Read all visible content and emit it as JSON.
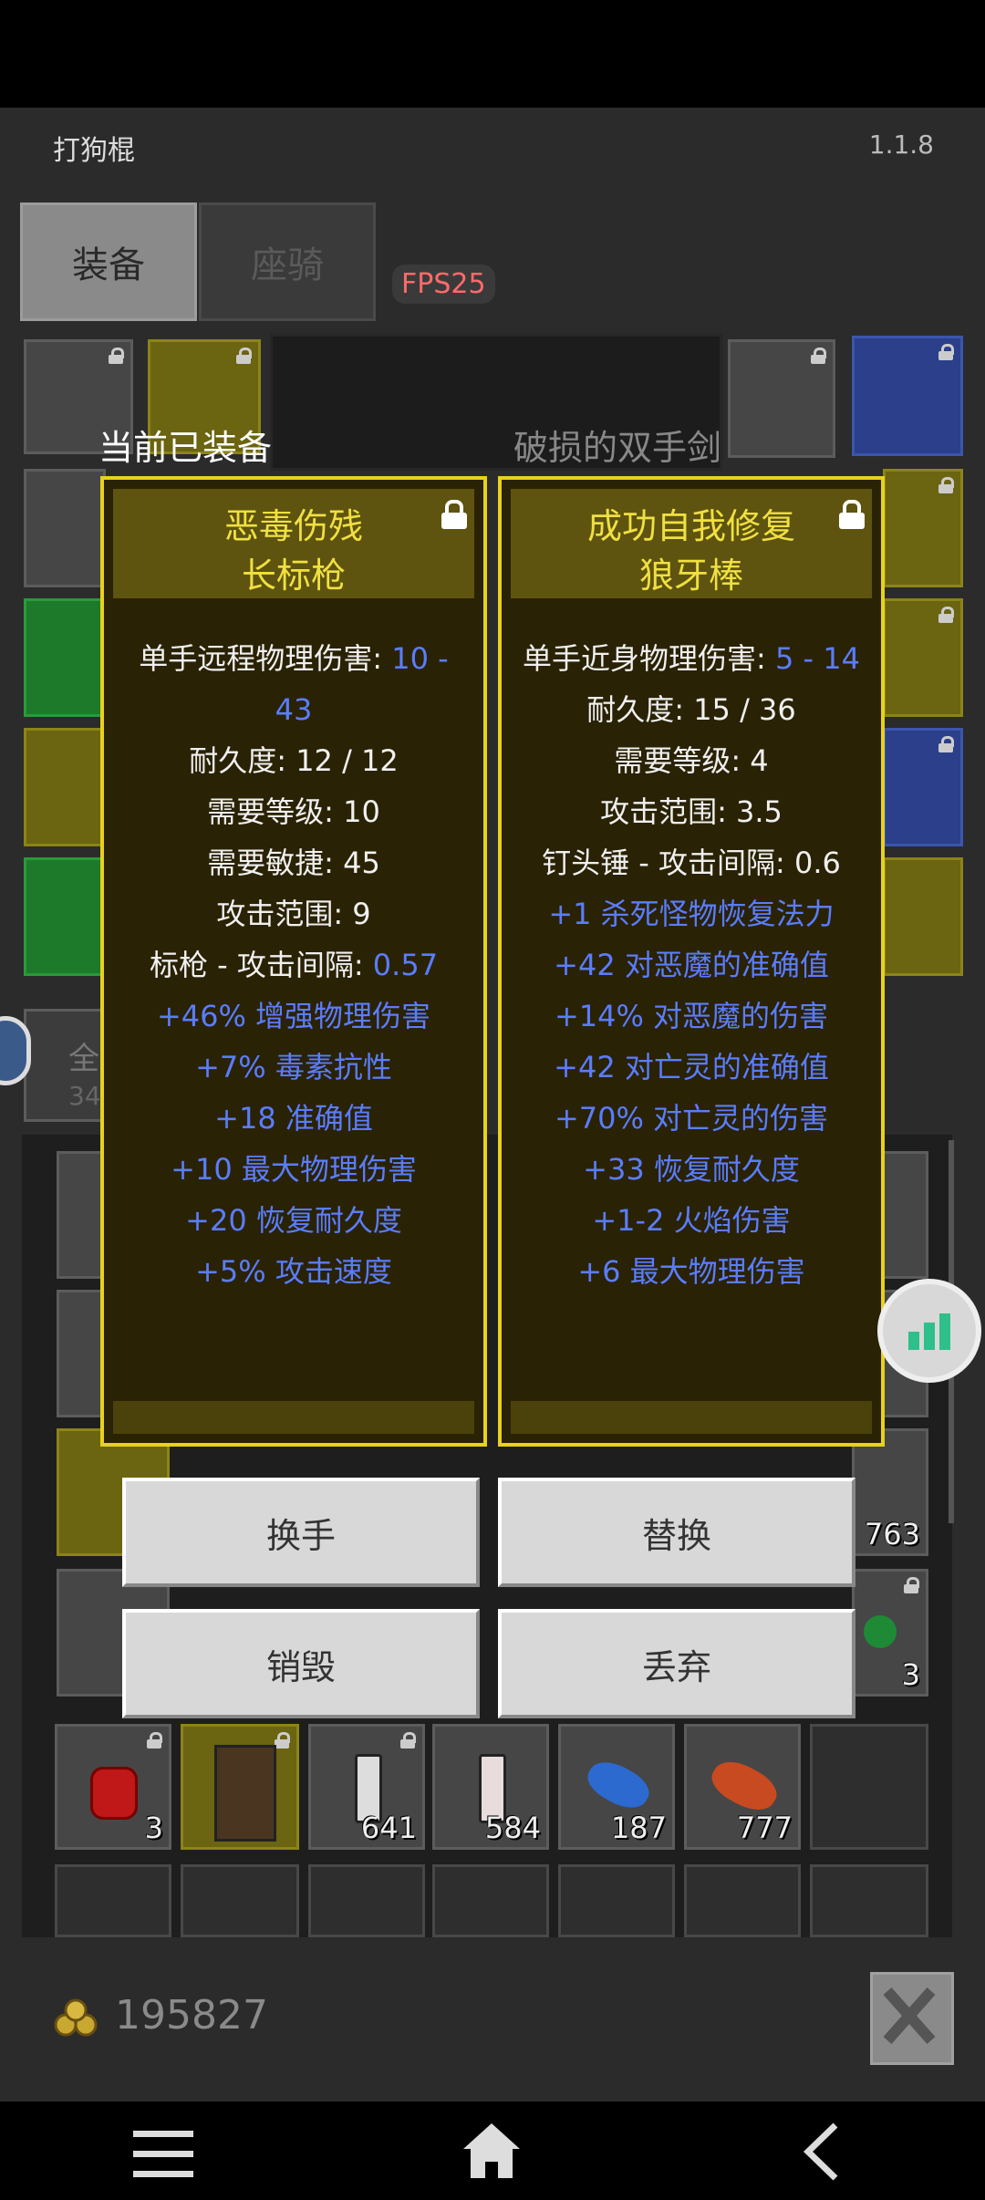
{
  "app": {
    "name": "打狗棍",
    "version": "1.1.8",
    "fps": "FPS25"
  },
  "tabs": [
    {
      "label": "装备"
    },
    {
      "label": "座骑"
    }
  ],
  "equip_banner": {
    "current": "当前已装备",
    "compare_name": "破损的双手剑"
  },
  "left_partial": {
    "tab_char": "全",
    "count": "34"
  },
  "panels": [
    {
      "title_line1": "恶毒伤残",
      "title_line2": "长标枪",
      "stats": [
        {
          "label": "单手远程物理伤害: ",
          "value": "10 -"
        },
        {
          "label": "",
          "value": "43"
        },
        {
          "label": "耐久度: 12 / 12",
          "value": ""
        },
        {
          "label": "需要等级: 10",
          "value": ""
        },
        {
          "label": "需要敏捷: 45",
          "value": ""
        },
        {
          "label": "攻击范围: 9",
          "value": ""
        },
        {
          "label": "标枪 - 攻击间隔: ",
          "value": "0.57"
        }
      ],
      "affixes": [
        "+46% 增强物理伤害",
        "+7% 毒素抗性",
        "+18 准确值",
        "+10 最大物理伤害",
        "+20 恢复耐久度",
        "+5% 攻击速度"
      ]
    },
    {
      "title_line1": "成功自我修复",
      "title_line2": "狼牙棒",
      "stats": [
        {
          "label": "单手近身物理伤害: ",
          "value": "5 - 14"
        },
        {
          "label": "耐久度: 15 / 36",
          "value": ""
        },
        {
          "label": "需要等级: 4",
          "value": ""
        },
        {
          "label": "攻击范围: 3.5",
          "value": ""
        },
        {
          "label": "钉头锤 - 攻击间隔: 0.6",
          "value": ""
        }
      ],
      "affixes": [
        "+1 杀死怪物恢复法力",
        "+42 对恶魔的准确值",
        "+14% 对恶魔的伤害",
        "+42 对亡灵的准确值",
        "+70% 对亡灵的伤害",
        "+33 恢复耐久度",
        "+1-2 火焰伤害",
        "+6 最大物理伤害"
      ]
    }
  ],
  "actions": {
    "swap_hand": "换手",
    "replace": "替换",
    "destroy": "销毁",
    "discard": "丢弃"
  },
  "inventory": {
    "qty_763": "763",
    "qty_3a": "3",
    "row": [
      {
        "qty": "3",
        "icon": "red-potion-icon"
      },
      {
        "qty": "",
        "icon": "leather-boots-icon"
      },
      {
        "qty": "641",
        "icon": "blue-vial-icon"
      },
      {
        "qty": "584",
        "icon": "red-vial-icon"
      },
      {
        "qty": "187",
        "icon": "blue-fish-icon"
      },
      {
        "qty": "777",
        "icon": "orange-fish-icon"
      }
    ]
  },
  "gold": "195827",
  "colors": {
    "panel_border": "#e8d21c",
    "title": "#f0e040",
    "affix": "#5a7dff",
    "fps": "#ff6a6a"
  }
}
